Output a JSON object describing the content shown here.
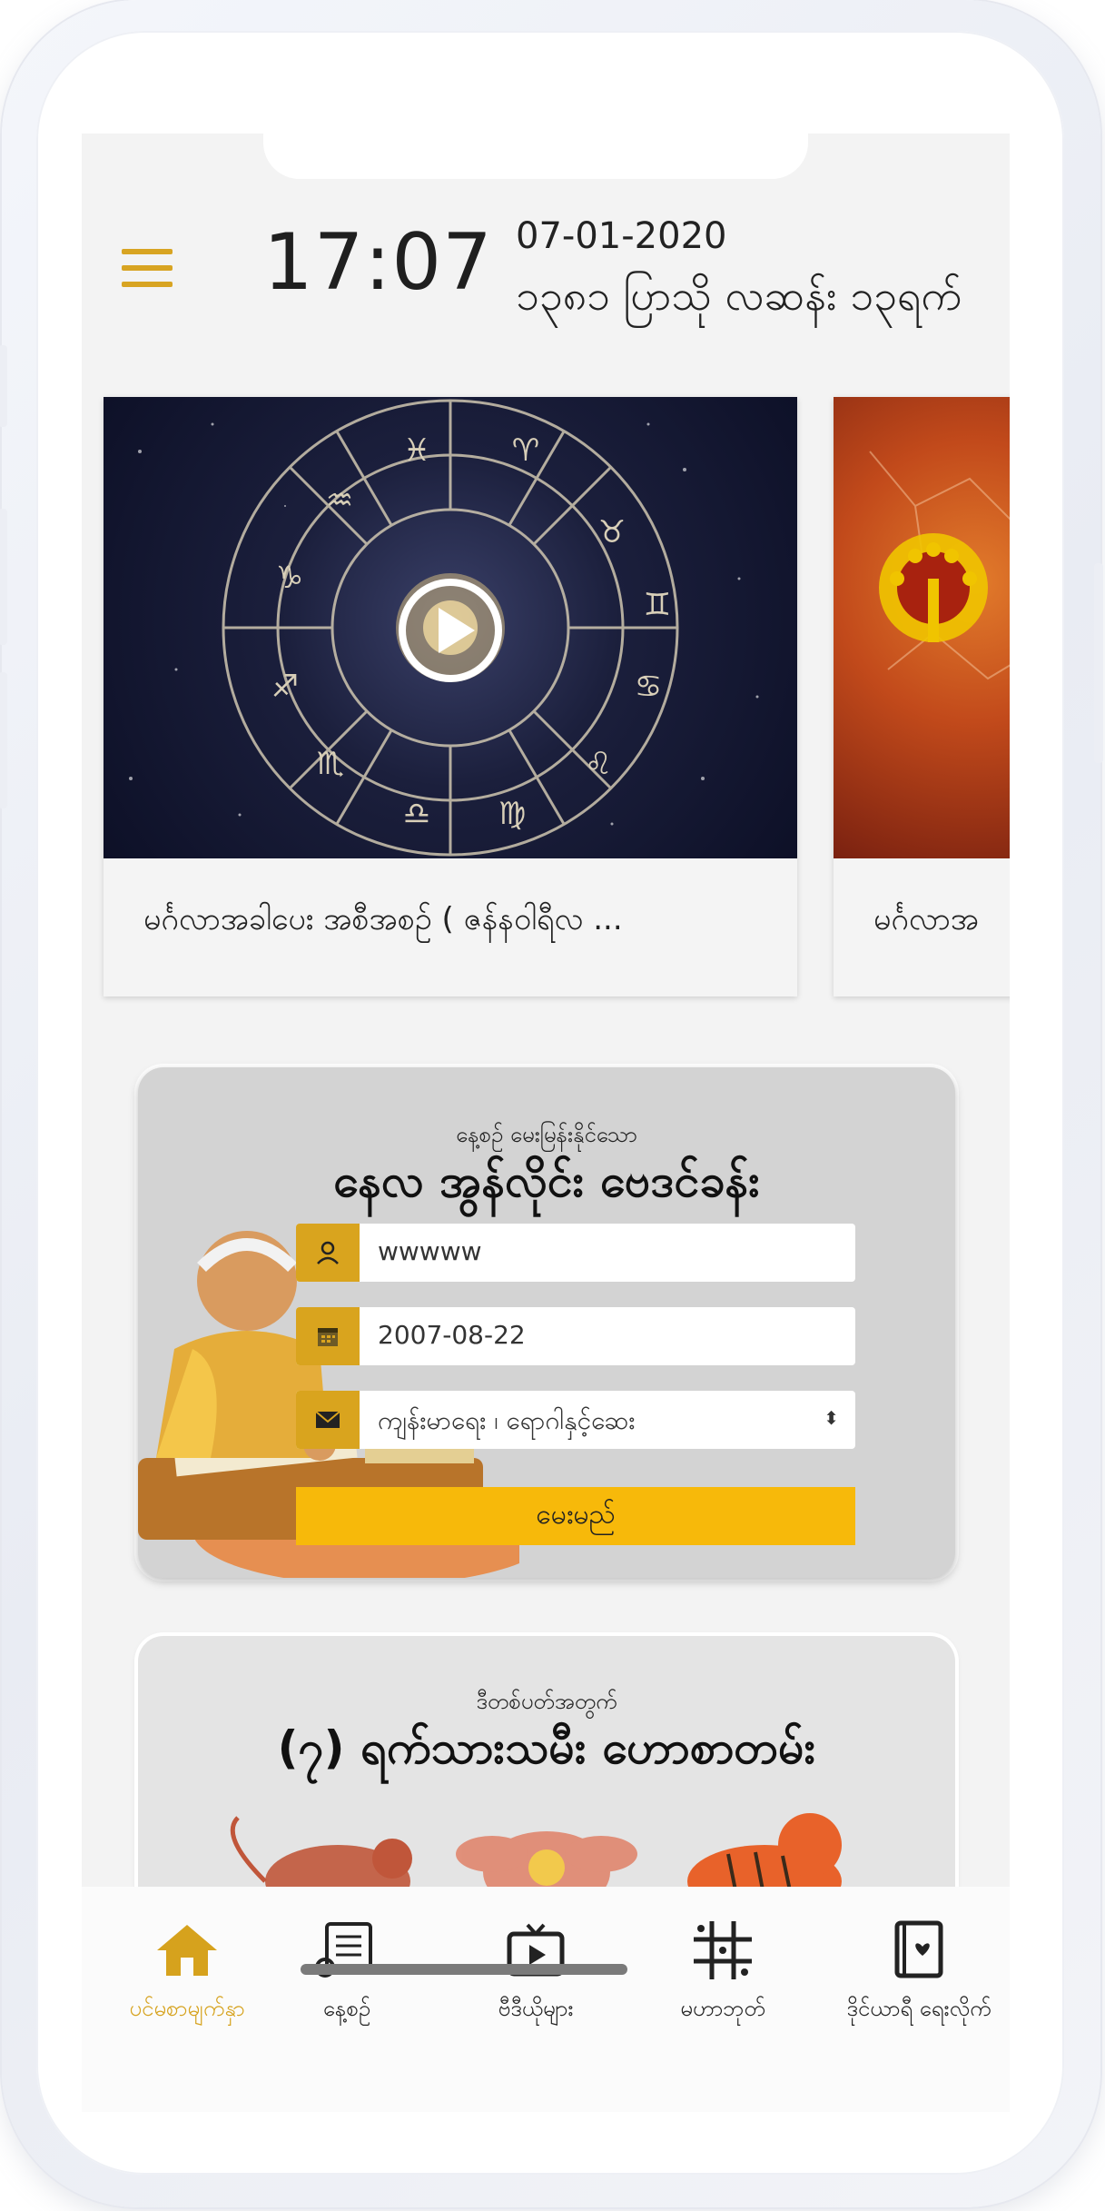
{
  "header": {
    "time": "17:07",
    "date_gregorian": "07-01-2020",
    "date_myanmar": "၁၃၈၁ ပြာသို လဆန်း ၁၃ရက်"
  },
  "videos": [
    {
      "title": "မင်္ဂလာအခါပေး အစီအစဉ် ( ဇန်နဝါရီလ ...",
      "thumb": "zodiac-wheel"
    },
    {
      "title": "မင်္ဂလာအ",
      "thumb": "peacock-constellation"
    }
  ],
  "horoscope_form": {
    "subtitle": "နေ့စဉ် မေးမြန်းနိုင်သော",
    "title": "နေလ အွန်လိုင်း ဗေဒင်ခန်း",
    "name_value": "wwwww",
    "birthdate_value": "2007-08-22",
    "topic_value": "ကျန်းမာရေး ၊ ရောဂါနှင့်ဆေး",
    "submit_label": "မေးမည်"
  },
  "promo_card": {
    "subtitle": "ဒီတစ်ပတ်အတွက်",
    "title": "(၇) ရက်သားသမီး ဟောစာတမ်း"
  },
  "bottom_nav": {
    "items": [
      {
        "label": "ပင်မစာမျက်နှာ",
        "icon": "home-icon",
        "active": true
      },
      {
        "label": "နေ့စဉ်",
        "icon": "scroll-icon",
        "active": false
      },
      {
        "label": "ဗီဒီယိုများ",
        "icon": "tv-icon",
        "active": false
      },
      {
        "label": "မဟာဘုတ်",
        "icon": "grid-icon",
        "active": false
      },
      {
        "label": "ဒိုင်ယာရီ ရေးလိုက်",
        "icon": "diary-icon",
        "active": false
      }
    ]
  },
  "colors": {
    "accent": "#d8a422",
    "button": "#f7b90a",
    "screen_bg": "#f3f3f3"
  }
}
